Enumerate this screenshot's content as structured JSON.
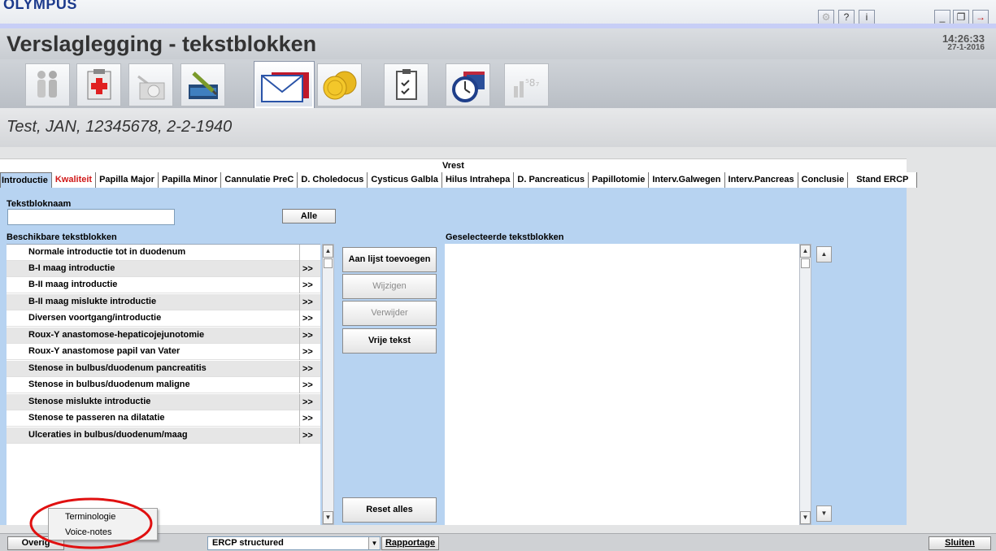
{
  "app": {
    "brand": "OLYMPUS",
    "title": "Verslaglegging - tekstblokken",
    "time": "14:26:33",
    "date": "27-1-2016",
    "window_buttons": {
      "settings": "⚙",
      "help": "?",
      "info": "i",
      "minimize": "_",
      "restore": "❐",
      "exit": "→"
    }
  },
  "modules": [
    {
      "icon": "patients-icon"
    },
    {
      "icon": "medical-record-icon"
    },
    {
      "icon": "camera-icon"
    },
    {
      "icon": "pen-image-icon"
    },
    {
      "icon": "report-envelope-icon",
      "active": true
    },
    {
      "icon": "coins-icon"
    },
    {
      "icon": "checklist-icon"
    },
    {
      "icon": "folder-clock-icon"
    },
    {
      "icon": "statistics-icon"
    }
  ],
  "patient": "Test, JAN, 12345678, 2-2-1940",
  "tabs": {
    "group_label": "Vrest",
    "items": [
      {
        "label": "Introductie",
        "active": true
      },
      {
        "label": "Kwaliteit",
        "color": "#d01818"
      },
      {
        "label": "Papilla Major"
      },
      {
        "label": "Papilla Minor"
      },
      {
        "label": "Cannulatie PreC"
      },
      {
        "label": "D. Choledocus"
      },
      {
        "label": "Cysticus Galbla"
      },
      {
        "label": "Hilus Intrahepa"
      },
      {
        "label": "D. Pancreaticus"
      },
      {
        "label": "Papillotomie"
      },
      {
        "label": "Interv.Galwegen"
      },
      {
        "label": "Interv.Pancreas"
      },
      {
        "label": "Conclusie"
      },
      {
        "label": "Stand ERCP"
      }
    ]
  },
  "form": {
    "name_label": "Tekstbloknaam",
    "name_value": "",
    "alle_button": "Alle",
    "available_label": "Beschikbare tekstblokken",
    "selected_label": "Geselecteerde tekstblokken"
  },
  "available": [
    {
      "label": "Normale introductie tot in duodenum",
      "arrow": ""
    },
    {
      "label": "B-I maag introductie",
      "arrow": ">>"
    },
    {
      "label": "B-II maag introductie",
      "arrow": ">>"
    },
    {
      "label": "B-II maag mislukte introductie",
      "arrow": ">>"
    },
    {
      "label": "Diversen voortgang/introductie",
      "arrow": ">>"
    },
    {
      "label": "Roux-Y anastomose-hepaticojejunotomie",
      "arrow": ">>"
    },
    {
      "label": "Roux-Y anastomose papil van Vater",
      "arrow": ">>"
    },
    {
      "label": "Stenose in bulbus/duodenum pancreatitis",
      "arrow": ">>"
    },
    {
      "label": "Stenose in bulbus/duodenum maligne",
      "arrow": ">>"
    },
    {
      "label": "Stenose mislukte introductie",
      "arrow": ">>"
    },
    {
      "label": "Stenose te passeren na dilatatie",
      "arrow": ">>"
    },
    {
      "label": "Ulceraties in bulbus/duodenum/maag",
      "arrow": ">>"
    }
  ],
  "actions": {
    "add": "Aan lijst toevoegen",
    "edit": "Wijzigen",
    "delete": "Verwijder",
    "free_text": "Vrije tekst",
    "reset": "Reset alles"
  },
  "bottom": {
    "overig": "Overig",
    "report_type": "ERCP structured",
    "rapportage": "Rapportage",
    "sluiten": "Sluiten"
  },
  "context_menu": {
    "items": [
      "Terminologie",
      "Voice-notes"
    ]
  },
  "colors": {
    "panel": "#b7d3f1",
    "active_tab": "#b9d4f2",
    "alert_tab": "#d01818",
    "annotation": "#e01010",
    "brand": "#1c3a8c"
  }
}
